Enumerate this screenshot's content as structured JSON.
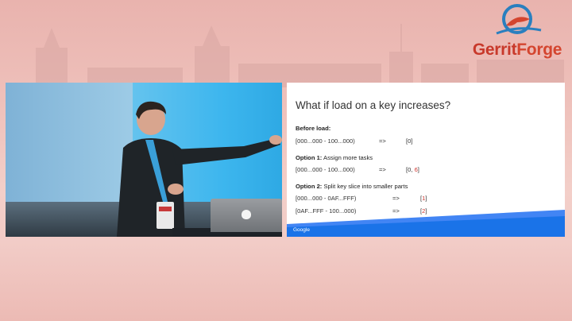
{
  "brand": {
    "logo_word_1": "Gerrit",
    "logo_word_2": "Forge",
    "colors": {
      "logo_red": "#d4452f",
      "logo_blue": "#2a7fbf"
    }
  },
  "video": {
    "laptop_logo": "apple-icon"
  },
  "slide": {
    "title": "What if load on a key increases?",
    "sections": [
      {
        "heading_bold": "Before load:",
        "heading_rest": "",
        "rows": [
          {
            "range": "[000...000 - 100...000)",
            "arrow": "=>",
            "result_plain": "[0]",
            "result_red": "",
            "result_close": ""
          }
        ]
      },
      {
        "heading_bold": "Option 1:",
        "heading_rest": " Assign more tasks",
        "rows": [
          {
            "range": "[000...000 - 100...000)",
            "arrow": "=>",
            "result_plain": "[0, ",
            "result_red": "6",
            "result_close": "]"
          }
        ]
      },
      {
        "heading_bold": "Option 2:",
        "heading_rest": " Split key slice into smaller parts",
        "rows": [
          {
            "range": "[000...000 - 0AF...FFF)",
            "arrow": "=>",
            "result_plain": "[",
            "result_red": "1",
            "result_close": "]"
          },
          {
            "range": "[0AF...FFF - 100...000)",
            "arrow": "=>",
            "result_plain": "[",
            "result_red": "2",
            "result_close": "]"
          }
        ]
      }
    ],
    "footer_label": "Google",
    "colors": {
      "accent_red": "#d0352f",
      "footer_blue": "#1a73e8"
    }
  }
}
